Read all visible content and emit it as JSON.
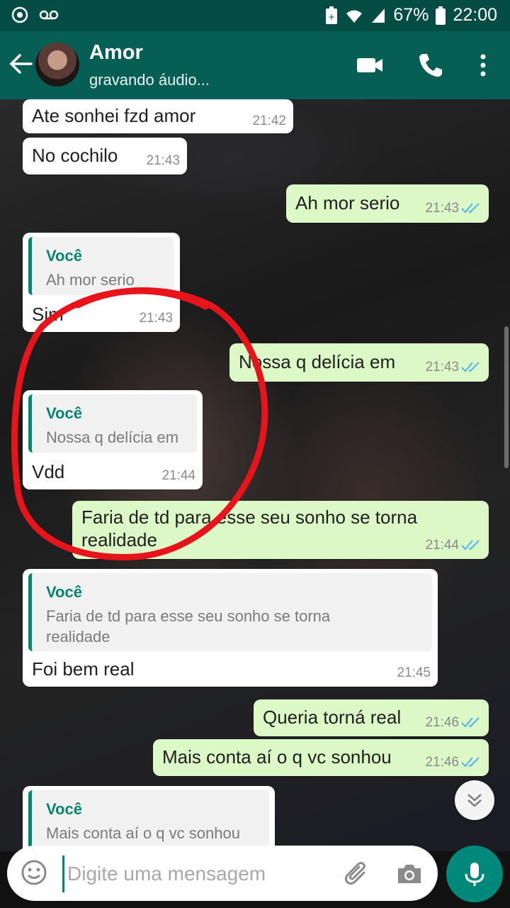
{
  "status_bar": {
    "battery": "67%",
    "time": "22:00"
  },
  "header": {
    "contact_name": "Amor",
    "status": "gravando áudio..."
  },
  "messages": [
    {
      "text": "Ate sonhei fzd amor",
      "time": "21:42"
    },
    {
      "text": "No cochilo",
      "time": "21:43"
    },
    {
      "text": "Ah mor serio",
      "time": "21:43"
    },
    {
      "quote_author": "Você",
      "quote_text": "Ah mor serio",
      "text": "Sim",
      "time": "21:43"
    },
    {
      "text": "Nossa q delícia em",
      "time": "21:43"
    },
    {
      "quote_author": "Você",
      "quote_text": "Nossa q delícia em",
      "text": "Vdd",
      "time": "21:44"
    },
    {
      "text_line1": "Faria de td para esse seu sonho se torna",
      "text_line2": "realidade",
      "time": "21:44"
    },
    {
      "quote_author": "Você",
      "quote_line1": "Faria de td para esse seu sonho se torna",
      "quote_line2": "realidade",
      "text": "Foi bem real",
      "time": "21:45"
    },
    {
      "text": "Queria torná real",
      "time": "21:46"
    },
    {
      "text": "Mais conta aí o q vc sonhou",
      "time": "21:46"
    },
    {
      "quote_author": "Você",
      "quote_text": "Mais conta aí o q vc sonhou"
    }
  ],
  "composer": {
    "placeholder": "Digite uma mensagem"
  },
  "colors": {
    "header": "#075e54",
    "outgoing": "#dcf8c6",
    "incoming": "#ffffff",
    "accent": "#00897b",
    "annotation": "#e8141c"
  }
}
